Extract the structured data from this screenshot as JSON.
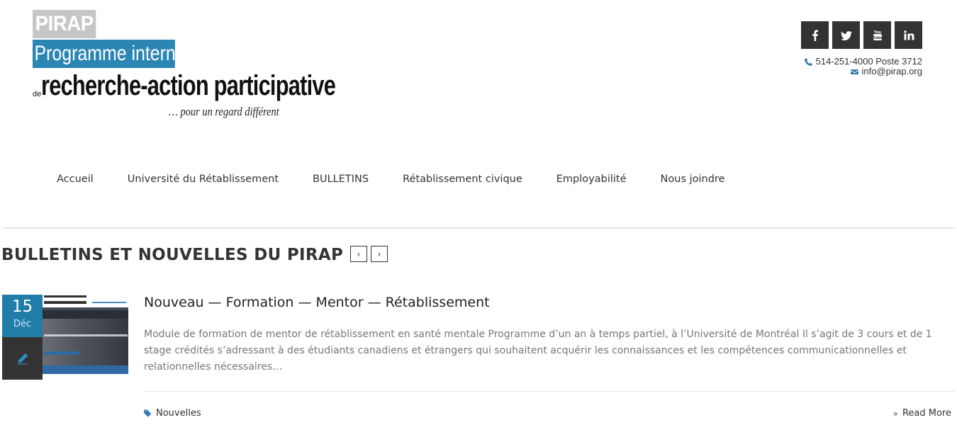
{
  "logo": {
    "pirap": "PIRAP",
    "programme": "Programme international",
    "de": "de",
    "recherche": "recherche-action participative",
    "tagline": "… pour un regard différent"
  },
  "social": [
    {
      "name": "facebook",
      "glyph": "f"
    },
    {
      "name": "twitter",
      "glyph": "t"
    },
    {
      "name": "youtube",
      "glyph": "You"
    },
    {
      "name": "linkedin",
      "glyph": "in"
    }
  ],
  "contact": {
    "phone": "514-251-4000 Poste 3712",
    "email": "info@pirap.org"
  },
  "nav": {
    "items": [
      "Accueil",
      "Université du Rétablissement",
      "BULLETINS",
      "Rétablissement civique",
      "Employabilité",
      "Nous joindre"
    ]
  },
  "section": {
    "title": "BULLETINS ET NOUVELLES DU PIRAP",
    "prev": "‹",
    "next": "›"
  },
  "post": {
    "day": "15",
    "month": "Déc",
    "title": "Nouveau — Formation — Mentor — Rétablissement",
    "excerpt": "Module de formation de mentor de rétablissement en santé mentale Programme d’un an à temps partiel, à l’Université de Montréal Il s’agit de 3 cours et de 1 stage crédités s’adressant à des étudiants canadiens et étrangers qui souhaitent acquérir les connaissances et les compétences communicationnelles et relationnelles nécessaires…",
    "tag": "Nouvelles",
    "read_more": "Read More"
  },
  "colors": {
    "accent": "#1f7da8",
    "dark": "#333333"
  }
}
